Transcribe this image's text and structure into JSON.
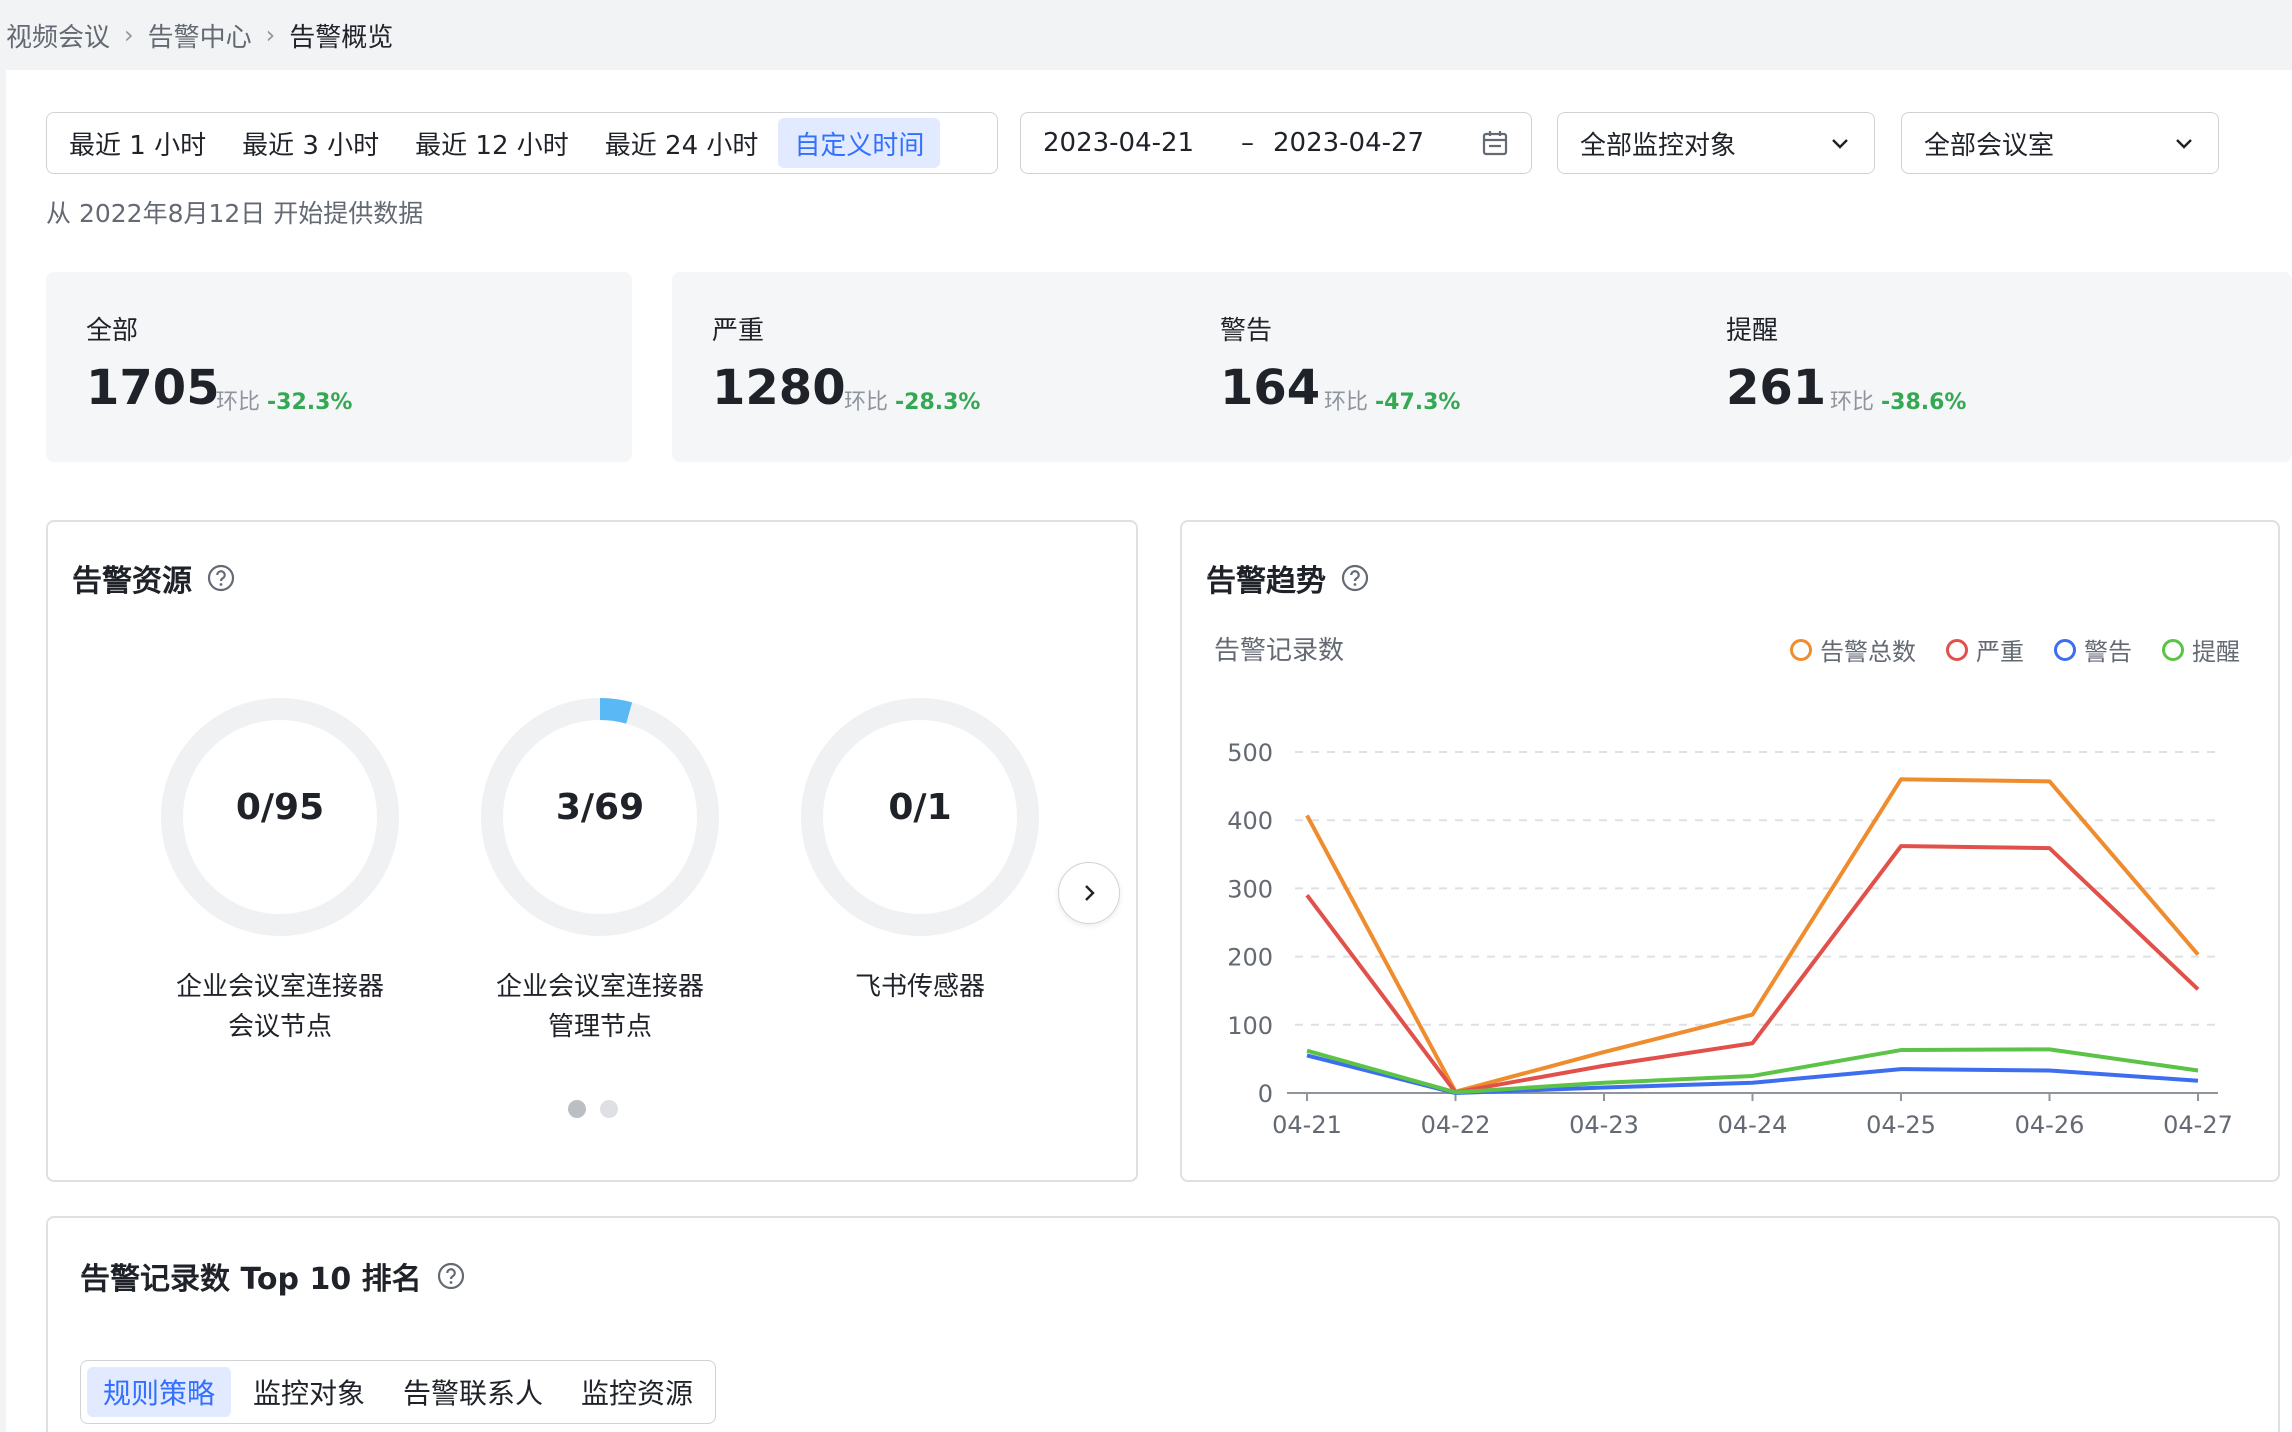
{
  "breadcrumb": {
    "items": [
      "视频会议",
      "告警中心",
      "告警概览"
    ]
  },
  "filters": {
    "time_ranges": [
      "最近 1 小时",
      "最近 3 小时",
      "最近 12 小时",
      "最近 24 小时",
      "自定义时间"
    ],
    "active_range": "自定义时间",
    "date_start": "2023-04-21",
    "date_end": "2023-04-27",
    "date_separator": "–",
    "monitor_select": "全部监控对象",
    "room_select": "全部会议室",
    "hint": "从 2022年8月12日 开始提供数据"
  },
  "stats": {
    "compare_label": "环比",
    "all": {
      "label": "全部",
      "value": "1705",
      "change": "-32.3%"
    },
    "severe": {
      "label": "严重",
      "value": "1280",
      "change": "-28.3%"
    },
    "warning": {
      "label": "警告",
      "value": "164",
      "change": "-47.3%"
    },
    "reminder": {
      "label": "提醒",
      "value": "261",
      "change": "-38.6%"
    }
  },
  "source_card": {
    "title": "告警资源",
    "rings": [
      {
        "value": "0/95",
        "fraction": 0,
        "label_line1": "企业会议室连接器",
        "label_line2": "会议节点"
      },
      {
        "value": "3/69",
        "fraction": 0.0435,
        "label_line1": "企业会议室连接器",
        "label_line2": "管理节点"
      },
      {
        "value": "0/1",
        "fraction": 0,
        "label_line1": "飞书传感器",
        "label_line2": ""
      }
    ],
    "page_count": 2,
    "current_page": 1
  },
  "trend_card": {
    "title": "告警趋势",
    "subtitle": "告警记录数"
  },
  "chart_data": {
    "type": "line",
    "x": [
      "04-21",
      "04-22",
      "04-23",
      "04-24",
      "04-25",
      "04-26",
      "04-27"
    ],
    "ylim": [
      0,
      500
    ],
    "yticks": [
      0,
      100,
      200,
      300,
      400,
      500
    ],
    "grid": true,
    "legend_position": "top-right",
    "series": [
      {
        "name": "告警总数",
        "color": "#ef8c2e",
        "values": [
          407,
          2,
          60,
          115,
          460,
          457,
          203
        ]
      },
      {
        "name": "严重",
        "color": "#e2504a",
        "values": [
          290,
          1,
          40,
          73,
          362,
          359,
          152
        ]
      },
      {
        "name": "警告",
        "color": "#3d6ef0",
        "values": [
          55,
          0,
          8,
          15,
          35,
          33,
          18
        ]
      },
      {
        "name": "提醒",
        "color": "#5bc446",
        "values": [
          62,
          1,
          15,
          25,
          63,
          64,
          33
        ]
      }
    ]
  },
  "top_card": {
    "title": "告警记录数 Top 10 排名",
    "tabs": [
      "规则策略",
      "监控对象",
      "告警联系人",
      "监控资源"
    ],
    "active_tab": "规则策略"
  },
  "colors": {
    "accent": "#3370ff",
    "accent_bg": "#e1eaff",
    "positive": "#34a853",
    "ring_track": "#f0f1f3",
    "ring_fill": "#5ab8f5"
  }
}
